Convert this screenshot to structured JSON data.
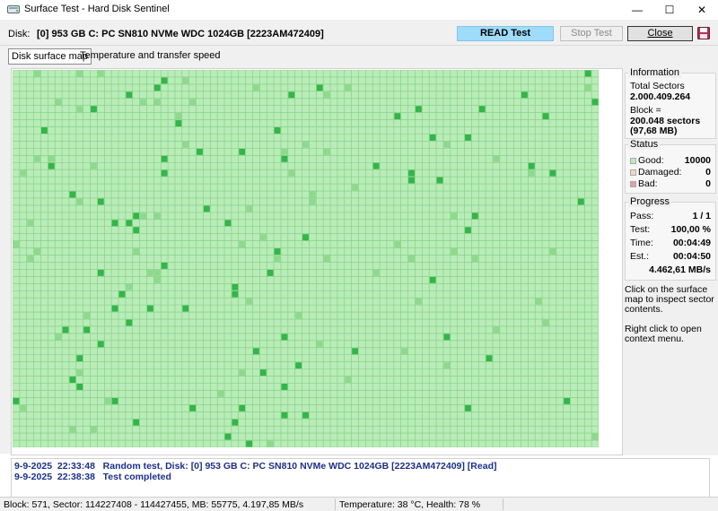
{
  "window": {
    "title": "Surface Test - Hard Disk Sentinel",
    "minimize_glyph": "—",
    "maximize_glyph": "☐",
    "close_glyph": "✕"
  },
  "toolbar": {
    "disk_label": "Disk:",
    "disk_name": "[0] 953 GB C: PC SN810 NVMe WDC 1024GB [2223AM472409]",
    "read_test_label": "READ Test",
    "stop_test_label": "Stop Test",
    "close_label": "Close",
    "save_icon": "floppy-save-icon"
  },
  "tabs": [
    {
      "label": "Disk surface map"
    },
    {
      "label": "Temperature and transfer speed"
    }
  ],
  "surface_map": {
    "columns": 83,
    "rows": 53,
    "good_color": "#b9ecb8",
    "grid_color": "#7fce7f",
    "highlight_color": "#33b54a",
    "highlight_light": "#8ed98d"
  },
  "information": {
    "title": "Information",
    "total_sectors_label": "Total Sectors",
    "total_sectors_value": "2.000.409.264",
    "block_label": "Block =",
    "block_value": "200.048 sectors",
    "block_mb": "(97,68 MB)"
  },
  "status": {
    "title": "Status",
    "good_label": "Good:",
    "good_value": "10000",
    "damaged_label": "Damaged:",
    "damaged_value": "0",
    "bad_label": "Bad:",
    "bad_value": "0",
    "good_color": "#b9ecb8",
    "damaged_color": "#f0d8c0",
    "bad_color": "#e0a0a0"
  },
  "progress": {
    "title": "Progress",
    "pass_label": "Pass:",
    "pass_value": "1 / 1",
    "test_label": "Test:",
    "test_value": "100,00 %",
    "time_label": "Time:",
    "time_value": "00:04:49",
    "est_label": "Est.:",
    "est_value": "00:04:50",
    "speed_value": "4.462,61 MB/s"
  },
  "notes": {
    "surface_hint": "Click on the surface map to inspect sector contents.",
    "context_hint": "Right click to open context menu."
  },
  "log": [
    {
      "date": "9-9-2025",
      "time": "22:33:48",
      "text": "Random test, Disk: [0] 953 GB C: PC SN810 NVMe WDC 1024GB [2223AM472409] [Read]"
    },
    {
      "date": "9-9-2025",
      "time": "22:38:38",
      "text": "Test completed"
    }
  ],
  "statusbar": {
    "block_info": "Block: 571, Sector: 114227408 - 114427455, MB: 55775, 4.197,85 MB/s",
    "temp_health": "Temperature: 38  °C, Health: 78 %"
  }
}
